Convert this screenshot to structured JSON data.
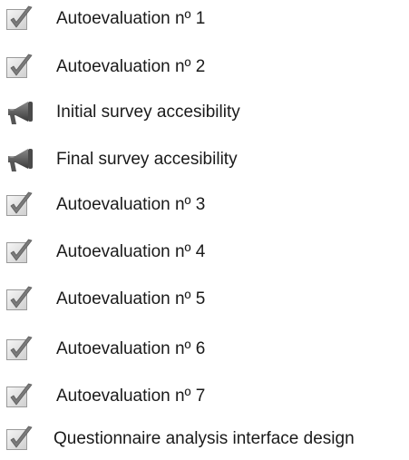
{
  "activities": [
    {
      "label": "Autoevaluation nº 1",
      "icon": "quiz-check-icon"
    },
    {
      "label": "Autoevaluation nº 2",
      "icon": "quiz-check-icon"
    },
    {
      "label": "Initial survey accesibility",
      "icon": "megaphone-icon"
    },
    {
      "label": "Final survey accesibility",
      "icon": "megaphone-icon"
    },
    {
      "label": "Autoevaluation nº 3",
      "icon": "quiz-check-icon"
    },
    {
      "label": "Autoevaluation nº 4",
      "icon": "quiz-check-icon"
    },
    {
      "label": "Autoevaluation nº 5",
      "icon": "quiz-check-icon"
    },
    {
      "label": "Autoevaluation nº 6",
      "icon": "quiz-check-icon"
    },
    {
      "label": "Autoevaluation nº 7",
      "icon": "quiz-check-icon"
    },
    {
      "label": "Questionnaire analysis interface design",
      "icon": "quiz-check-icon"
    }
  ]
}
